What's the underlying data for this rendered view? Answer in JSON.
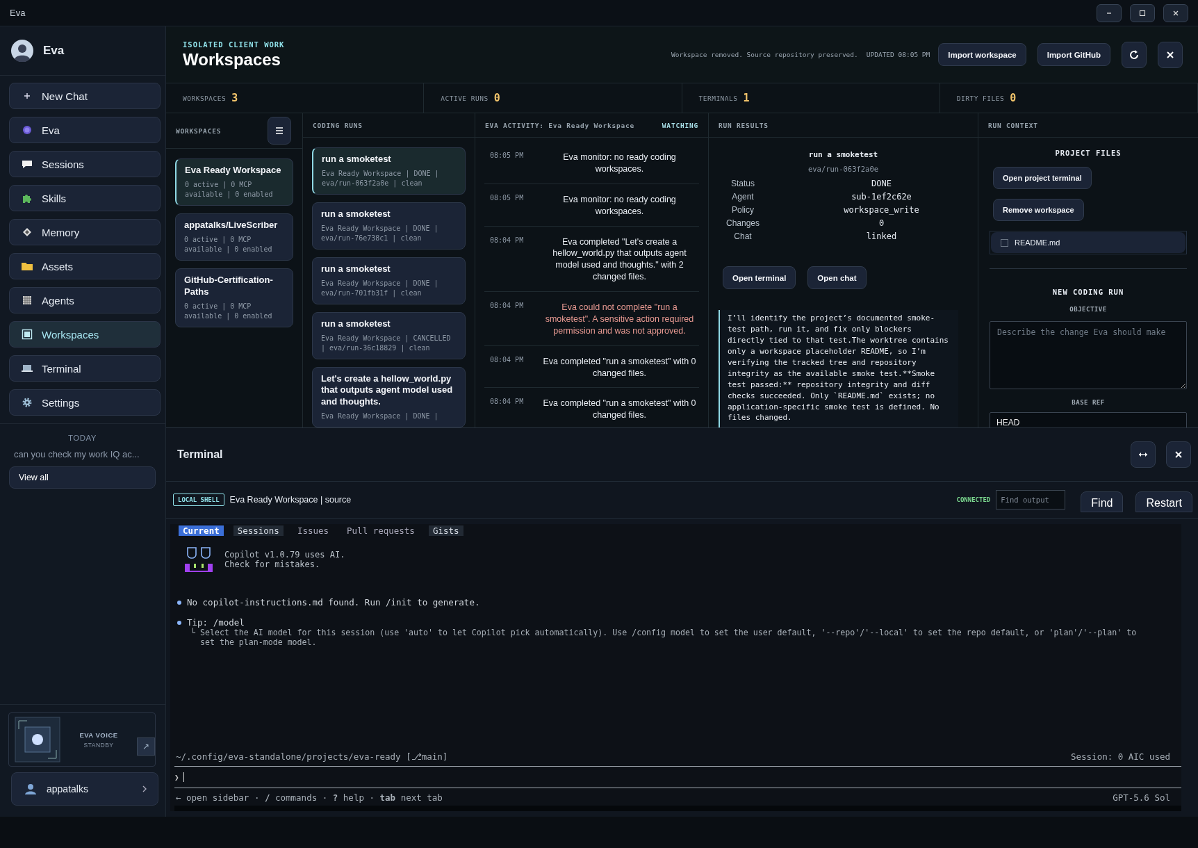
{
  "window": {
    "title": "Eva"
  },
  "sidebar": {
    "brand": "Eva",
    "nav": [
      {
        "label": "New Chat",
        "selected": false
      },
      {
        "label": "Eva",
        "selected": false
      },
      {
        "label": "Sessions",
        "selected": false
      },
      {
        "label": "Skills",
        "selected": false
      },
      {
        "label": "Memory",
        "selected": false
      },
      {
        "label": "Assets",
        "selected": false
      },
      {
        "label": "Agents",
        "selected": false
      },
      {
        "label": "Workspaces",
        "selected": true
      },
      {
        "label": "Terminal",
        "selected": false
      },
      {
        "label": "Settings",
        "selected": false
      }
    ],
    "history_heading": "TODAY",
    "history": [
      "can you check my work IQ ac..."
    ],
    "view_all": "View all",
    "voice": {
      "title": "EVA VOICE",
      "status": "STANDBY",
      "expand": "↗"
    },
    "user": "appatalks"
  },
  "header": {
    "eyebrow": "ISOLATED CLIENT WORK",
    "title": "Workspaces",
    "status": "Workspace removed. Source repository preserved.",
    "updated": "UPDATED 08:05 PM",
    "buttons": [
      "Import workspace",
      "Import GitHub"
    ]
  },
  "stats": [
    {
      "label": "WORKSPACES",
      "value": "3"
    },
    {
      "label": "ACTIVE RUNS",
      "value": "0"
    },
    {
      "label": "TERMINALS",
      "value": "1"
    },
    {
      "label": "DIRTY FILES",
      "value": "0"
    }
  ],
  "workspaces": {
    "heading": "WORKSPACES",
    "items": [
      {
        "name": "Eva Ready Workspace",
        "meta": "0 active | 0 MCP available | 0 enabled",
        "selected": true
      },
      {
        "name": "appatalks/LiveScriber",
        "meta": "0 active | 0 MCP available | 0 enabled",
        "selected": false
      },
      {
        "name": "GitHub-Certification-Paths",
        "meta": "0 active | 0 MCP available | 0 enabled",
        "selected": false
      }
    ]
  },
  "coding_runs": {
    "heading": "CODING RUNS",
    "items": [
      {
        "title": "run a smoketest",
        "meta": "Eva Ready Workspace | DONE | eva/run-063f2a0e | clean",
        "selected": true
      },
      {
        "title": "run a smoketest",
        "meta": "Eva Ready Workspace | DONE | eva/run-76e738c1 | clean",
        "selected": false
      },
      {
        "title": "run a smoketest",
        "meta": "Eva Ready Workspace | DONE | eva/run-701fb31f | clean",
        "selected": false
      },
      {
        "title": "run a smoketest",
        "meta": "Eva Ready Workspace | CANCELLED | eva/run-36c18829 | clean",
        "selected": false
      },
      {
        "title": "Let's create a hellow_world.py that outputs agent model used and thoughts.",
        "meta": "Eva Ready Workspace | DONE |",
        "selected": false
      }
    ]
  },
  "activity": {
    "heading": "EVA ACTIVITY: Eva Ready Workspace",
    "badge": "WATCHING",
    "entries": [
      {
        "time": "08:05 PM",
        "text": "Eva monitor: no ready coding workspaces.",
        "kind": "info"
      },
      {
        "time": "08:05 PM",
        "text": "Eva monitor: no ready coding workspaces.",
        "kind": "info"
      },
      {
        "time": "08:04 PM",
        "text": "Eva completed \"Let's create a hellow_world.py that outputs agent model used and thoughts.\" with 2 changed files.",
        "kind": "info"
      },
      {
        "time": "08:04 PM",
        "text": "Eva could not complete \"run a smoketest\". A sensitive action required permission and was not approved.",
        "kind": "error"
      },
      {
        "time": "08:04 PM",
        "text": "Eva completed \"run a smoketest\" with 0 changed files.",
        "kind": "info"
      },
      {
        "time": "08:04 PM",
        "text": "Eva completed \"run a smoketest\" with 0 changed files.",
        "kind": "info"
      }
    ]
  },
  "results": {
    "heading": "RUN RESULTS",
    "title": "run a smoketest",
    "branch": "eva/run-063f2a0e",
    "fields": [
      {
        "label": "Status",
        "value": "DONE"
      },
      {
        "label": "Agent",
        "value": "sub-1ef2c62e"
      },
      {
        "label": "Policy",
        "value": "workspace_write"
      },
      {
        "label": "Changes",
        "value": "0"
      },
      {
        "label": "Chat",
        "value": "linked"
      }
    ],
    "buttons": [
      "Open terminal",
      "Open chat"
    ],
    "log": "I’ll identify the project’s documented smoke-test path, run it, and fix only blockers directly tied to that test.The worktree contains only a workspace placeholder README, so I’m verifying the tracked tree and repository integrity as the available smoke test.**Smoke test passed:** repository integrity and diff checks succeeded. Only `README.md` exists; no application-specific smoke test is defined. No files changed."
  },
  "context": {
    "heading": "RUN CONTEXT",
    "files_heading": "PROJECT FILES",
    "buttons": [
      "Open project terminal",
      "Remove workspace"
    ],
    "files": [
      {
        "name": "README.md",
        "checked": false
      }
    ],
    "new_run_heading": "NEW CODING RUN",
    "objective_label": "OBJECTIVE",
    "objective_placeholder": "Describe the change Eva should make",
    "base_ref_label": "BASE REF",
    "base_ref": "HEAD"
  },
  "terminal": {
    "title": "Terminal",
    "shell_badge": "LOCAL SHELL",
    "target": "Eva Ready Workspace | source",
    "status": "CONNECTED",
    "find_placeholder": "Find output",
    "buttons": [
      "Find",
      "Restart"
    ],
    "tabs": [
      {
        "label": "Current",
        "selected": true,
        "shaded": false
      },
      {
        "label": "Sessions",
        "selected": false,
        "shaded": true
      },
      {
        "label": "Issues",
        "selected": false,
        "shaded": false
      },
      {
        "label": "Pull requests",
        "selected": false,
        "shaded": false
      },
      {
        "label": "Gists",
        "selected": false,
        "shaded": true
      }
    ],
    "banner": [
      "Copilot v1.0.79 uses AI.",
      "Check for mistakes."
    ],
    "lines": [
      {
        "kind": "bullet",
        "text": "No copilot-instructions.md found. Run /init to generate."
      },
      {
        "kind": "bullet",
        "text": "Tip: /model"
      },
      {
        "kind": "sub",
        "text": "└ Select the AI model for this session (use 'auto' to let Copilot pick automatically). Use /config model to set the user default, '--repo'/'--local' to set the repo default, or 'plan'/'--plan' to set the plan-mode model."
      }
    ],
    "path": "~/.config/eva-standalone/projects/eva-ready [⎇main]",
    "usage": "Session: 0 AIC used",
    "prompt": "❯",
    "hints": "← open sidebar · **/** commands · **?** help · **tab** next tab",
    "model": "GPT-5.6 Sol"
  }
}
